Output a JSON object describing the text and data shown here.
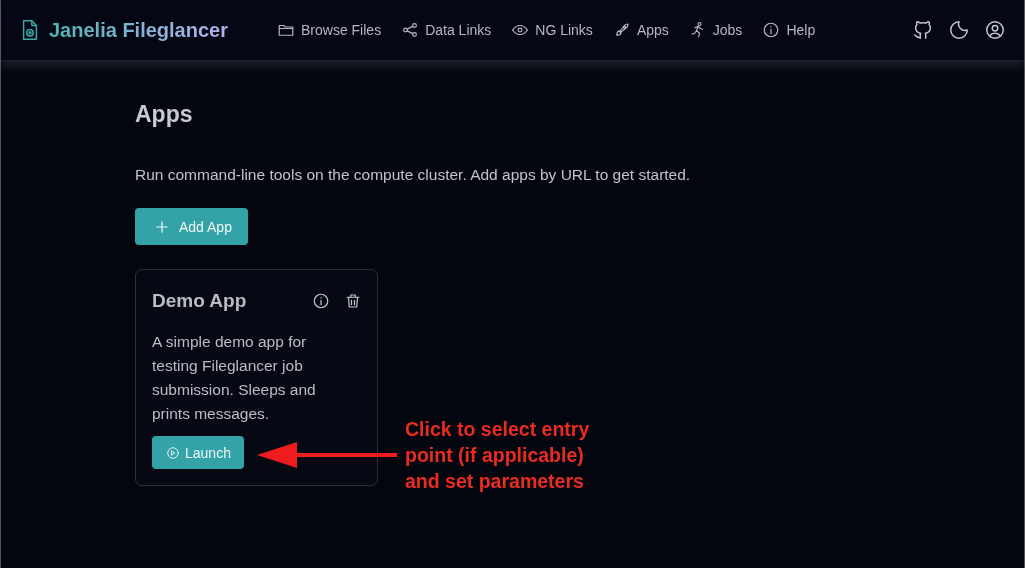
{
  "header": {
    "title": "Janelia Fileglancer",
    "nav": [
      {
        "label": "Browse Files"
      },
      {
        "label": "Data Links"
      },
      {
        "label": "NG Links"
      },
      {
        "label": "Apps"
      },
      {
        "label": "Jobs"
      },
      {
        "label": "Help"
      }
    ]
  },
  "page": {
    "heading": "Apps",
    "description": "Run command-line tools on the compute cluster. Add apps by URL to get started.",
    "add_button": "Add App"
  },
  "apps": [
    {
      "name": "Demo App",
      "description": "A simple demo app for testing Fileglancer job submission. Sleeps and prints messages.",
      "launch": "Launch"
    }
  ],
  "annotation": {
    "text": "Click to select entry point (if applicable) and set parameters"
  }
}
